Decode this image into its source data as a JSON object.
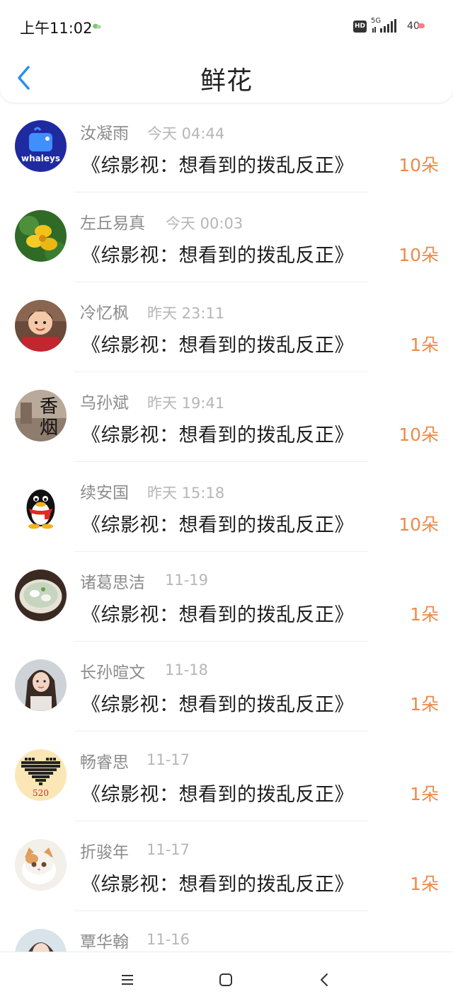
{
  "status_bar": {
    "time": "上午11:02",
    "hd": "HD",
    "network": "5G",
    "battery": "40"
  },
  "header": {
    "title": "鲜花"
  },
  "icons": {
    "back": "chevron-left-icon",
    "menu": "menu-icon",
    "home": "square-home-icon",
    "nav_back": "chevron-left-icon"
  },
  "colors": {
    "count": "#ec8a4a",
    "back": "#2a8ef0",
    "name": "#8c8c8c",
    "time": "#b6b6b6"
  },
  "list": [
    {
      "name": "汝凝雨",
      "time": "今天 04:44",
      "message": "《综影视：想看到的拨乱反正》",
      "count": "10朵",
      "avatar": "whaleys"
    },
    {
      "name": "左丘易真",
      "time": "今天 00:03",
      "message": "《综影视：想看到的拨乱反正》",
      "count": "10朵",
      "avatar": "yellow-flower"
    },
    {
      "name": "冷忆枫",
      "time": "昨天 23:11",
      "message": "《综影视：想看到的拨乱反正》",
      "count": "1朵",
      "avatar": "child-photo"
    },
    {
      "name": "乌孙斌",
      "time": "昨天 19:41",
      "message": "《综影视：想看到的拨乱反正》",
      "count": "10朵",
      "avatar": "text-香烟"
    },
    {
      "name": "续安国",
      "time": "昨天 15:18",
      "message": "《综影视：想看到的拨乱反正》",
      "count": "10朵",
      "avatar": "qq-penguin"
    },
    {
      "name": "诸葛思洁",
      "time": "11-19",
      "message": "《综影视：想看到的拨乱反正》",
      "count": "1朵",
      "avatar": "food-bowl"
    },
    {
      "name": "长孙暄文",
      "time": "11-18",
      "message": "《综影视：想看到的拨乱反正》",
      "count": "1朵",
      "avatar": "girl-photo"
    },
    {
      "name": "畅睿思",
      "time": "11-17",
      "message": "《综影视：想看到的拨乱反正》",
      "count": "1朵",
      "avatar": "pixel-heart-520"
    },
    {
      "name": "折骏年",
      "time": "11-17",
      "message": "《综影视：想看到的拨乱反正》",
      "count": "1朵",
      "avatar": "cat-photo"
    },
    {
      "name": "覃华翰",
      "time": "11-16",
      "message": "",
      "count": "",
      "avatar": "girl-photo-2"
    }
  ],
  "avatar_text": {
    "whaleys": "whaleys",
    "xiangyan": "香烟",
    "heart": "520"
  }
}
